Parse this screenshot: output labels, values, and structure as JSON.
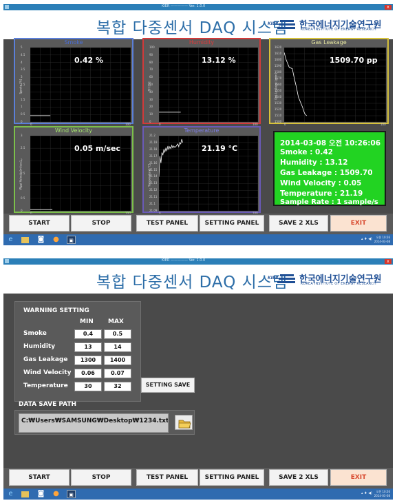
{
  "window": {
    "title_text": "KIER ————— Ver. 1.0.0",
    "close_glyph": "x"
  },
  "header": {
    "app_title": "복합 다중센서 DAQ 시스템",
    "logo_mark": "KIER",
    "logo_korean": "한국에너지기술연구원",
    "logo_english": "KOREA INSTITUTE OF ENERGY RESEARCH"
  },
  "monitor": {
    "panels": [
      {
        "title": "Smoke",
        "title_color": "#4a6ed8",
        "border_color": "#5b7fd8",
        "readout": "0.42 %",
        "ylabel": "Smoke [%]",
        "y_ticks": [
          "5",
          "4.5",
          "4",
          "3.5",
          "3",
          "2.5",
          "2",
          "1.5",
          "1",
          "0.5",
          "0"
        ],
        "x_ticks": [
          "0",
          "100"
        ]
      },
      {
        "title": "Humidity",
        "title_color": "#e03a3a",
        "border_color": "#d23a3a",
        "readout": "13.12 %",
        "ylabel": "RH [%]",
        "y_ticks": [
          "100",
          "90",
          "80",
          "70",
          "60",
          "50",
          "40",
          "30",
          "20",
          "10",
          "0"
        ],
        "x_ticks": [
          "0",
          "100"
        ]
      },
      {
        "title": "Gas Leakage",
        "title_color": "#e8e8a0",
        "border_color": "#d6c23a",
        "readout": "1509.70 pp",
        "ylabel": "Gas Leakage [ppm]",
        "y_ticks": [
          "1620",
          "1610",
          "1600",
          "1590",
          "1580",
          "1570",
          "1560",
          "1550",
          "1540",
          "1530",
          "1520",
          "1510",
          "1500"
        ],
        "x_ticks": [
          "0",
          "100"
        ]
      },
      {
        "title": "Wind Velocity",
        "title_color": "#a8e870",
        "border_color": "#7cc04a",
        "readout": "0.05 m/sec",
        "ylabel": "Wind Velocity[m/sec]",
        "y_ticks": [
          "3",
          "2.5",
          "2",
          "1.5",
          "1",
          "0.5",
          "0"
        ],
        "x_ticks": [
          "0",
          "100"
        ]
      },
      {
        "title": "Temperature",
        "title_color": "#8080e8",
        "border_color": "#6a5ab8",
        "readout": "21.19 °C",
        "ylabel": "Temperature[°C]",
        "y_ticks": [
          "21.2",
          "21.19",
          "21.18",
          "21.17",
          "21.16",
          "21.15",
          "21.14",
          "21.13",
          "21.12",
          "21.11",
          "21.1",
          "21.09"
        ],
        "x_ticks": [
          "0",
          "100"
        ]
      }
    ],
    "status": {
      "timestamp": "2014-03-08 오전 10:26:06",
      "smoke": "Smoke : 0.42",
      "humidity": "Humidity : 13.12",
      "gas": "Gas Leakage : 1509.70",
      "wind": "Wind Velocity : 0.05",
      "temperature": "Temperature : 21.19",
      "sample_rate": "Sample Rate : 1 sample/s"
    }
  },
  "chart_data": [
    {
      "type": "line",
      "title": "Smoke",
      "ylabel": "Smoke [%]",
      "xlim": [
        0,
        100
      ],
      "ylim": [
        0,
        5
      ],
      "series": [
        {
          "x": [
            0,
            20
          ],
          "y": [
            0.42,
            0.42
          ]
        }
      ]
    },
    {
      "type": "line",
      "title": "Humidity",
      "ylabel": "RH [%]",
      "xlim": [
        0,
        100
      ],
      "ylim": [
        0,
        100
      ],
      "series": [
        {
          "x": [
            0,
            22
          ],
          "y": [
            13.12,
            13.12
          ]
        }
      ]
    },
    {
      "type": "line",
      "title": "Gas Leakage",
      "ylabel": "Gas Leakage [ppm]",
      "xlim": [
        0,
        100
      ],
      "ylim": [
        1500,
        1620
      ],
      "series": [
        {
          "x": [
            0,
            2,
            5,
            8,
            10,
            12,
            14,
            16,
            18,
            20,
            22
          ],
          "y": [
            1612,
            1600,
            1588,
            1586,
            1570,
            1556,
            1540,
            1532,
            1524,
            1514,
            1510
          ]
        }
      ]
    },
    {
      "type": "line",
      "title": "Wind Velocity",
      "ylabel": "Wind Velocity[m/sec]",
      "xlim": [
        0,
        100
      ],
      "ylim": [
        0,
        3
      ],
      "series": [
        {
          "x": [
            0,
            22
          ],
          "y": [
            0.05,
            0.05
          ]
        }
      ]
    },
    {
      "type": "line",
      "title": "Temperature",
      "ylabel": "Temperature[°C]",
      "xlim": [
        0,
        100
      ],
      "ylim": [
        21.09,
        21.2
      ],
      "series": [
        {
          "x": [
            0,
            1,
            2,
            3,
            4,
            5,
            6,
            7,
            8,
            9,
            10,
            11,
            12,
            13,
            14,
            15,
            16,
            17,
            18,
            19,
            20,
            21,
            22,
            23,
            24
          ],
          "y": [
            21.14,
            21.17,
            21.16,
            21.175,
            21.172,
            21.18,
            21.176,
            21.182,
            21.178,
            21.185,
            21.18,
            21.184,
            21.181,
            21.186,
            21.182,
            21.185,
            21.183,
            21.184,
            21.186,
            21.188,
            21.184,
            21.19,
            21.188,
            21.195,
            21.19
          ]
        }
      ]
    }
  ],
  "buttons": {
    "start": "START",
    "stop": "STOP",
    "test_panel": "TEST PANEL",
    "setting_panel": "SETTING PANEL",
    "save_xls": "SAVE 2 XLS",
    "exit": "EXIT"
  },
  "taskbar": {
    "clock_time": "오전 10:26",
    "clock_date": "2014-03-08",
    "clock_time_2": "오전 10:26",
    "clock_date_2": "2014-03-08",
    "tray_text": "▴ ♦ ◀)",
    "icons": [
      "ie-icon",
      "explorer-icon",
      "media-icon",
      "firefox-icon",
      "app-icon"
    ]
  },
  "settings": {
    "warning_title": "WARNING SETTING",
    "col_min": "MIN",
    "col_max": "MAX",
    "rows": [
      {
        "label": "Smoke",
        "min": "0.4",
        "max": "0.5"
      },
      {
        "label": "Humidity",
        "min": "13",
        "max": "14"
      },
      {
        "label": "Gas Leakage",
        "min": "1300",
        "max": "1400"
      },
      {
        "label": "Wind Velocity",
        "min": "0.06",
        "max": "0.07"
      },
      {
        "label": "Temperature",
        "min": "30",
        "max": "32"
      }
    ],
    "save_button": "SETTING SAVE",
    "path_title": "DATA SAVE PATH",
    "path_value": "C:₩Users₩SAMSUNG₩Desktop₩1234.txt"
  }
}
